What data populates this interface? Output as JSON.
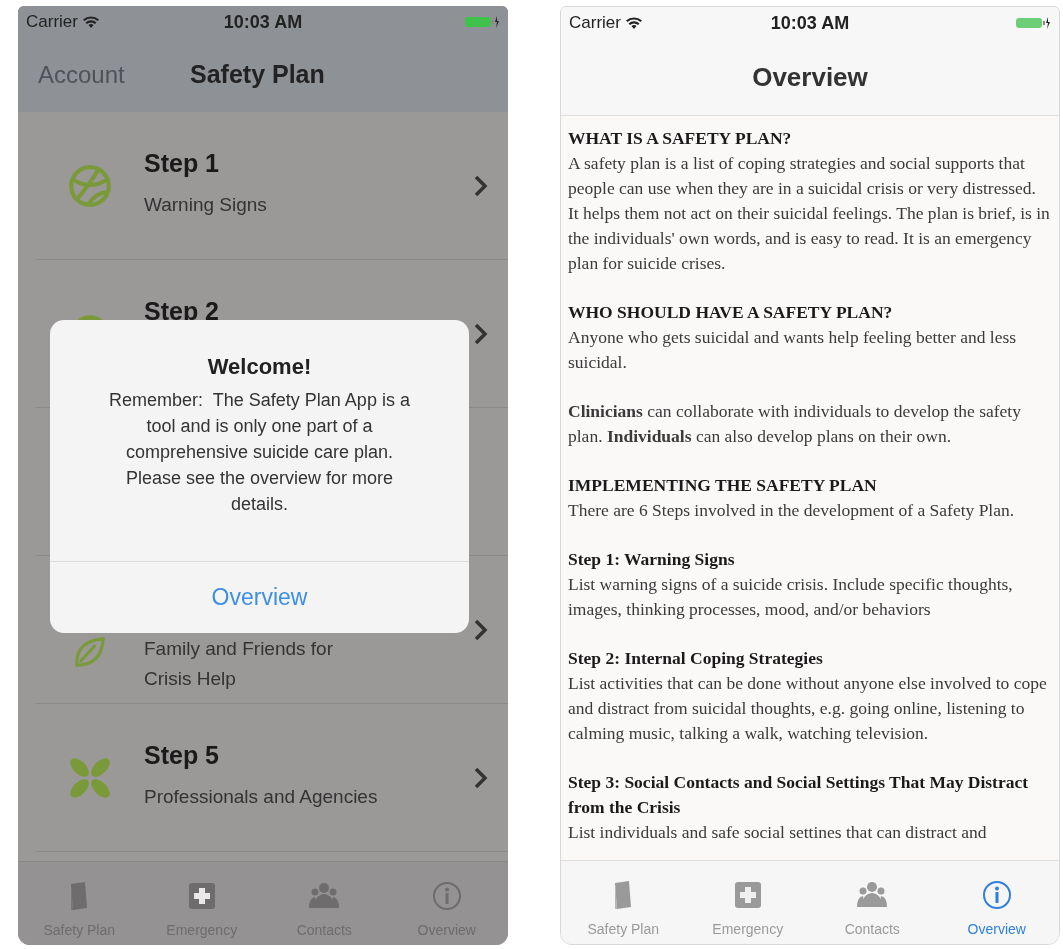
{
  "left_screen": {
    "status_bar": {
      "carrier": "Carrier",
      "time": "10:03 AM"
    },
    "nav_bar": {
      "back": "Account",
      "title": "Safety Plan"
    },
    "rows": [
      {
        "kind": "step",
        "title": "Step 1",
        "subtitle": "Warning Signs"
      },
      {
        "kind": "step",
        "title": "Step 2"
      },
      {
        "kind": "covered"
      },
      {
        "kind": "step",
        "subtitle": "Family and Friends for Crisis Help"
      },
      {
        "kind": "step",
        "title": "Step 5",
        "subtitle": "Professionals and Agencies"
      }
    ],
    "alert": {
      "title": "Welcome!",
      "message": "Remember:  The Safety Plan App is a tool and is only one part of a comprehensive suicide care plan. Please see the overview for more details.",
      "button": "Overview"
    },
    "tabs": [
      {
        "label": "Safety Plan",
        "selected": false
      },
      {
        "label": "Emergency",
        "selected": false
      },
      {
        "label": "Contacts",
        "selected": false
      },
      {
        "label": "Overview",
        "selected": false
      }
    ]
  },
  "right_screen": {
    "status_bar": {
      "carrier": "Carrier",
      "time": "10:03 AM"
    },
    "nav_bar": {
      "title": "Overview"
    },
    "sections": [
      {
        "heading": "WHAT IS A SAFETY PLAN?",
        "paragraphs": [
          "A safety plan is a list of coping strategies and social supports that people can use when they are in a suicidal crisis or very distressed. It helps them not act on their suicidal feelings. The plan is brief, is in the individuals' own words, and is easy to read. It is an emergency plan for suicide crises."
        ]
      },
      {
        "heading": "WHO SHOULD HAVE A SAFETY PLAN?",
        "paragraphs": [
          "Anyone who gets suicidal and wants help feeling better and less suicidal.",
          "**Clinicians** can collaborate with individuals to develop the safety plan. **Individuals** can also develop plans on their own."
        ]
      },
      {
        "heading": "IMPLEMENTING THE SAFETY PLAN",
        "paragraphs": [
          "There are 6 Steps involved in the development of a Safety Plan."
        ]
      },
      {
        "heading": "Step 1: Warning Signs",
        "paragraphs": [
          "List warning signs of a suicide crisis. Include specific thoughts, images, thinking processes, mood, and/or behaviors"
        ]
      },
      {
        "heading": "Step 2: Internal Coping Strategies",
        "paragraphs": [
          "List activities that can be done without anyone else involved to cope and distract from suicidal thoughts, e.g. going online, listening to calming music, talking a walk, watching television."
        ]
      },
      {
        "heading": "Step 3: Social Contacts and Social Settings That May Distract from the Crisis",
        "paragraphs": [
          "List individuals and safe social settines that can distract and"
        ]
      }
    ],
    "tabs": [
      {
        "label": "Safety Plan",
        "selected": false
      },
      {
        "label": "Emergency",
        "selected": false
      },
      {
        "label": "Contacts",
        "selected": false
      },
      {
        "label": "Overview",
        "selected": true
      }
    ]
  }
}
